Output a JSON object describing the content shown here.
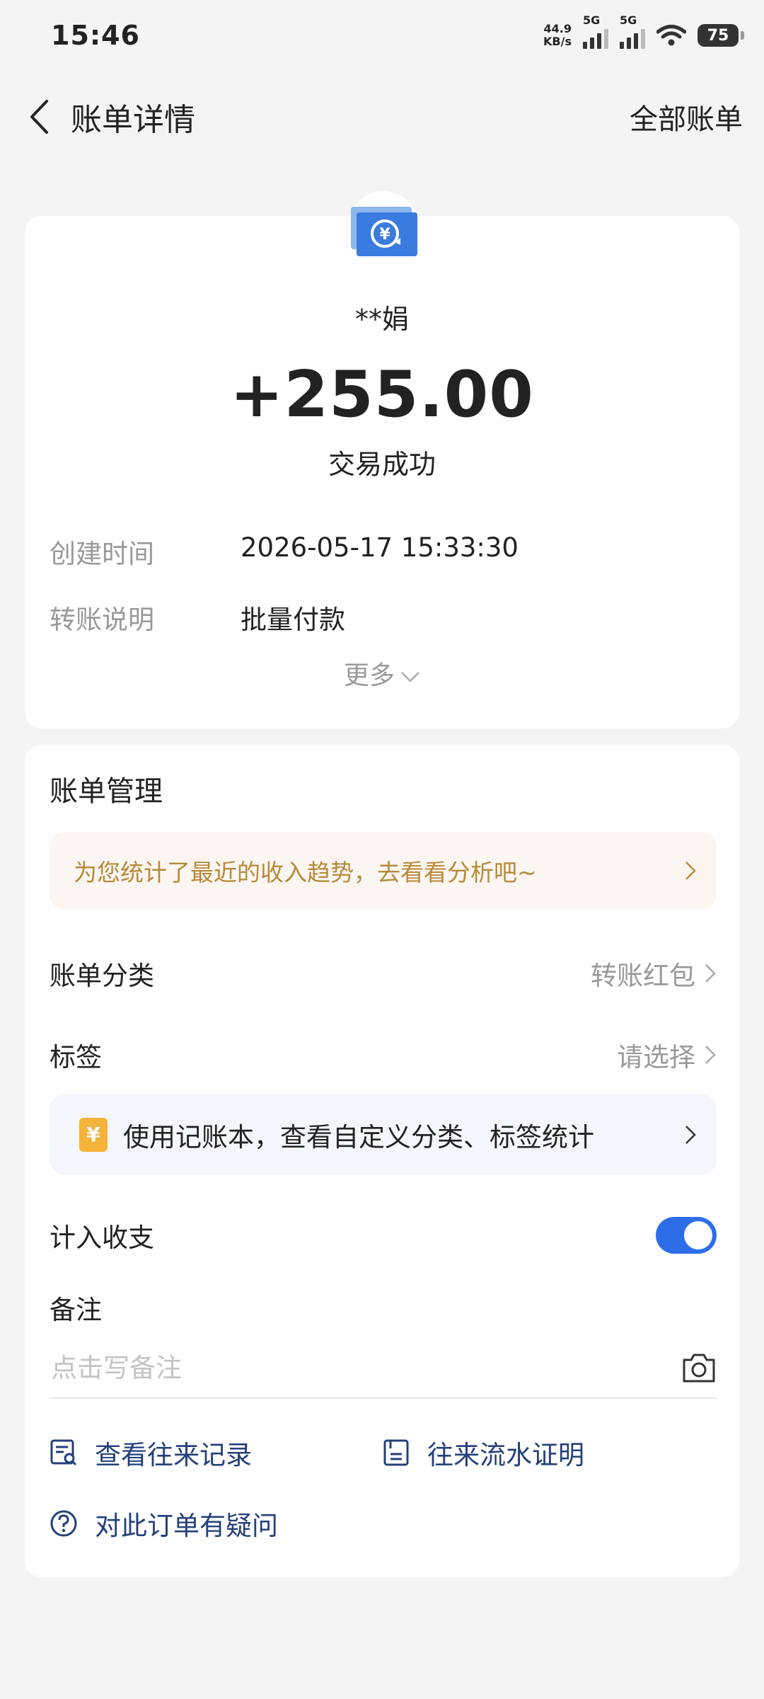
{
  "status_bar": {
    "time": "15:46",
    "net_speed_value": "44.9",
    "net_speed_unit": "KB/s",
    "signal_1_tag": "5G",
    "signal_2_tag": "5G",
    "battery": "75"
  },
  "header": {
    "title": "账单详情",
    "right_link": "全部账单"
  },
  "transaction": {
    "payer": "**娟",
    "amount": "+255.00",
    "status": "交易成功",
    "created_label": "创建时间",
    "created_value": "2026-05-17 15:33:30",
    "note_label": "转账说明",
    "note_value": "批量付款",
    "more": "更多"
  },
  "management": {
    "title": "账单管理",
    "promo_text": "为您统计了最近的收入趋势，去看看分析吧~",
    "category_label": "账单分类",
    "category_value": "转账红包",
    "tag_label": "标签",
    "tag_value": "请选择",
    "book_icon_glyph": "¥",
    "book_text": "使用记账本，查看自定义分类、标签统计",
    "count_label": "计入收支",
    "count_enabled": true,
    "remark_label": "备注",
    "remark_placeholder": "点击写备注"
  },
  "links": {
    "history": "查看往来记录",
    "statement": "往来流水证明",
    "question": "对此订单有疑问"
  },
  "colors": {
    "accent": "#2d6ee8",
    "link": "#24407a",
    "promo_text": "#b78a3a",
    "promo_bg": "#fbf6f1"
  }
}
